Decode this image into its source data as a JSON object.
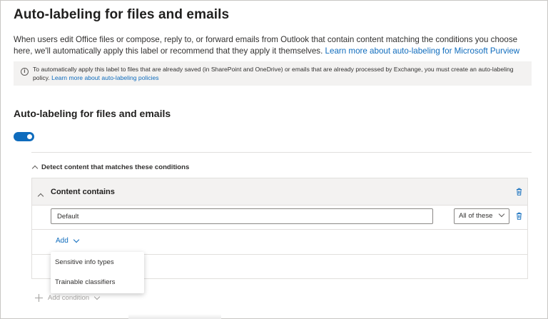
{
  "page": {
    "title": "Auto-labeling for files and emails",
    "intro_text": "When users edit Office files or compose, reply to, or forward emails from Outlook that contain content matching the conditions you choose here, we'll automatically apply this label or recommend that they apply it themselves. ",
    "intro_link": "Learn more about auto-labeling for Microsoft Purview"
  },
  "info_bar": {
    "icon": "info-icon",
    "text": "To automatically apply this label to files that are already saved (in SharePoint and OneDrive) or emails that are already processed by Exchange, you must create an auto-labeling policy. ",
    "link": "Learn more about auto-labeling policies"
  },
  "auto_labeling": {
    "section_title": "Auto-labeling for files and emails",
    "toggle_on": true
  },
  "conditions": {
    "detect_label": "Detect content that matches these conditions",
    "group": {
      "title": "Content contains",
      "input_value": "Default",
      "match_select": "All of these",
      "add_label": "Add"
    },
    "add_menu": {
      "items": [
        "Sensitive info types",
        "Trainable classifiers"
      ]
    },
    "add_condition_label": "Add condition"
  },
  "colors": {
    "accent": "#0f6cbd",
    "info_bg": "#f3f2f1",
    "border": "#e1dfdd"
  }
}
